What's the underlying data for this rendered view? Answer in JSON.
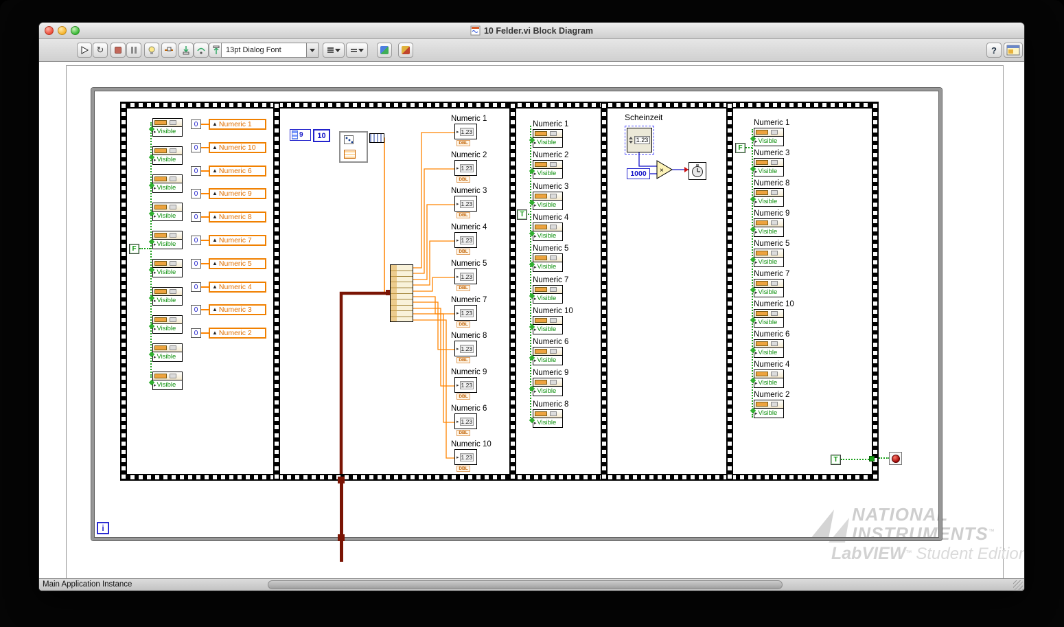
{
  "window": {
    "title": "10 Felder.vi Block Diagram",
    "status_text": "Main Application Instance"
  },
  "toolbar": {
    "font_selector": "13pt Dialog Font",
    "icons": {
      "run_continuously": "↻",
      "help": "?"
    },
    "button_names": [
      "run",
      "run-continuously",
      "abort",
      "pause",
      "highlight-execution",
      "retain-wire-values",
      "step-into",
      "step-over",
      "step-out",
      "text-settings",
      "align-objects",
      "distribute-objects",
      "clean-up-diagram",
      "reorder-objects",
      "help",
      "context-help"
    ]
  },
  "watermark": {
    "brand_line1": "NATIONAL",
    "brand_line2": "INSTRUMENTS",
    "trademark": "™",
    "product": "LabVIEW",
    "edition": "Student Edition"
  },
  "diagram": {
    "glyphs": {
      "expand_arrow": "▸",
      "write_arrow": "▲"
    },
    "while_loop": {
      "iteration_terminal": "i"
    },
    "frame1": {
      "boolean_constant": "F",
      "visible_label": "Visible",
      "property_node_count": 10,
      "locals": [
        {
          "value": "0",
          "label": "Numeric 1"
        },
        {
          "value": "0",
          "label": "Numeric 10"
        },
        {
          "value": "0",
          "label": "Numeric 6"
        },
        {
          "value": "0",
          "label": "Numeric 9"
        },
        {
          "value": "0",
          "label": "Numeric 8"
        },
        {
          "value": "0",
          "label": "Numeric 7"
        },
        {
          "value": "0",
          "label": "Numeric 5"
        },
        {
          "value": "0",
          "label": "Numeric 4"
        },
        {
          "value": "0",
          "label": "Numeric 3"
        },
        {
          "value": "0",
          "label": "Numeric 2"
        }
      ]
    },
    "frame2": {
      "array_size_constant": "9",
      "count_constant": "10",
      "indicator_icon_text": "1.23",
      "terminal_type": "DBL",
      "indicators": [
        "Numeric 1",
        "Numeric 2",
        "Numeric 3",
        "Numeric 4",
        "Numeric 5",
        "Numeric 7",
        "Numeric 8",
        "Numeric 9",
        "Numeric 6",
        "Numeric 10"
      ]
    },
    "frame3": {
      "boolean_constant": "T",
      "visible_label": "Visible",
      "properties": [
        "Numeric 1",
        "Numeric 2",
        "Numeric 3",
        "Numeric 4",
        "Numeric 5",
        "Numeric 7",
        "Numeric 10",
        "Numeric 6",
        "Numeric 9",
        "Numeric 8"
      ]
    },
    "frame4": {
      "control_label": "Scheinzeit",
      "control_icon_text": "1.23",
      "multiplier_constant": "1000",
      "multiply_glyph": "×"
    },
    "frame5": {
      "boolean_constant": "F",
      "stop_constant": "T",
      "visible_label": "Visible",
      "properties": [
        "Numeric 1",
        "Numeric 3",
        "Numeric 8",
        "Numeric 9",
        "Numeric 5",
        "Numeric 7",
        "Numeric 10",
        "Numeric 6",
        "Numeric 4",
        "Numeric 2"
      ]
    }
  }
}
